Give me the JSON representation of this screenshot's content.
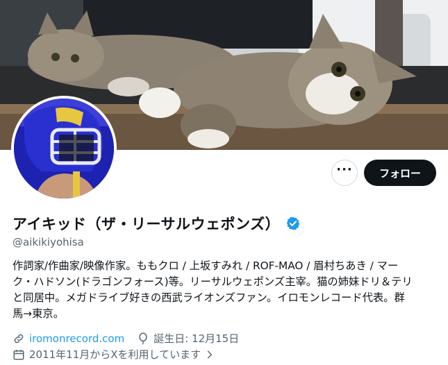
{
  "profile": {
    "display_name": "アイキッド（ザ・リーサルウェポンズ）",
    "handle": "@aikikiyohisa",
    "bio_lines": [
      "作詞家/作曲家/映像作家。ももクロ / 上坂すみれ / ROF-MAO / 眉村ちあき / マー",
      "ク・ハドソン(ドラゴンフォース)等。リーサルウェポンズ主宰。猫の姉妹ドリ＆テリ",
      "と同居中。メガドライブ好きの西武ライオンズファン。イロモンレコード代表。群",
      "馬→東京。"
    ],
    "website": "iromonrecord.com",
    "birthday": "誕生日: 12月15日",
    "joined": "2011年11月からXを利用しています",
    "verified": true
  },
  "actions": {
    "more_label": "···",
    "follow_label": "フォロー"
  },
  "icons": {
    "more": "more-dots-icon",
    "verified": "verified-badge-icon",
    "link": "link-icon",
    "birthday": "balloon-icon",
    "calendar": "calendar-icon",
    "chevron": "chevron-right-icon"
  },
  "colors": {
    "accent": "#1d9bf0",
    "text": "#0f1419",
    "secondary": "#536471",
    "follow_bg": "#0f1419"
  }
}
